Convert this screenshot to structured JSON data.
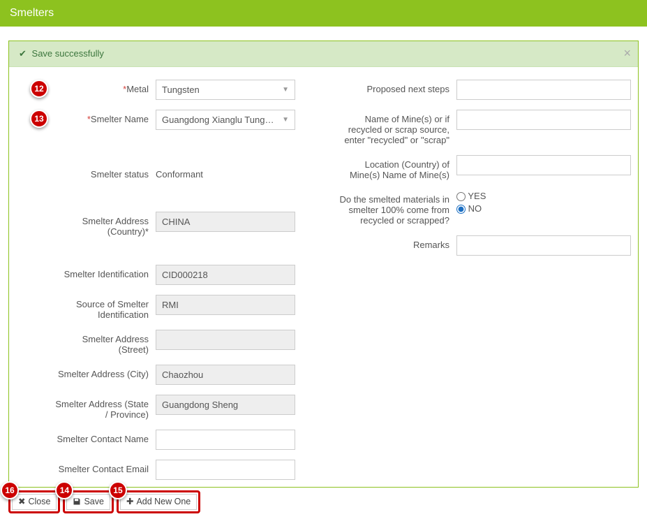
{
  "header": {
    "title": "Smelters"
  },
  "alert": {
    "message": "Save successfully"
  },
  "badges": {
    "metal": "12",
    "smelter_name": "13",
    "save": "14",
    "add_new": "15",
    "close": "16"
  },
  "left": {
    "metal_label": "Metal",
    "metal_value": "Tungsten",
    "smelter_name_label": "Smelter Name",
    "smelter_name_value": "Guangdong Xianglu Tung…",
    "status_label": "Smelter status",
    "status_value": "Conformant",
    "country_label": "Smelter Address (Country)*",
    "country_value": "CHINA",
    "id_label": "Smelter Identification",
    "id_value": "CID000218",
    "source_label": "Source of Smelter Identification",
    "source_value": "RMI",
    "street_label": "Smelter Address (Street)",
    "street_value": "",
    "city_label": "Smelter Address (City)",
    "city_value": "Chaozhou",
    "state_label": "Smelter Address (State / Province)",
    "state_value": "Guangdong Sheng",
    "contact_name_label": "Smelter Contact Name",
    "contact_name_value": "",
    "contact_email_label": "Smelter Contact Email",
    "contact_email_value": ""
  },
  "right": {
    "next_steps_label": "Proposed next steps",
    "next_steps_value": "",
    "mine_label": "Name of Mine(s) or if recycled or scrap source, enter \"recycled\" or \"scrap\"",
    "mine_value": "",
    "location_label": "Location (Country) of Mine(s) Name of Mine(s)",
    "location_value": "",
    "recycled_label": "Do the smelted materials in smelter 100% come from recycled or scrapped?",
    "recycled_yes": "YES",
    "recycled_no": "NO",
    "recycled_selected": "NO",
    "remarks_label": "Remarks",
    "remarks_value": ""
  },
  "buttons": {
    "close": "Close",
    "save": "Save",
    "add_new": "Add New One"
  }
}
